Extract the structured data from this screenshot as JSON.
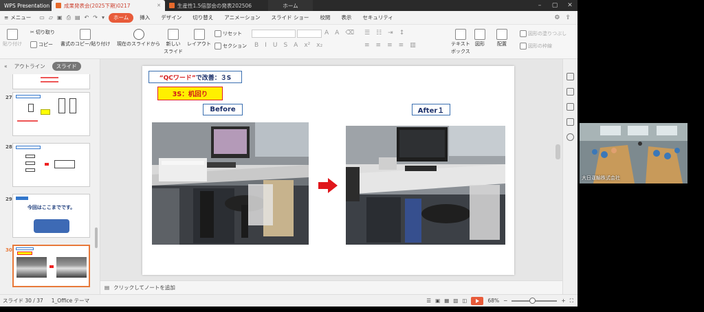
{
  "titlebar": {
    "app": "WPS Presentation",
    "doc1": "成果発表会(2025下期)0217",
    "doc2": "生産性1.5倍部会の発表202506",
    "home": "ホーム"
  },
  "menubar": {
    "menu": "メニュー",
    "tabs": [
      "ホーム",
      "挿入",
      "デザイン",
      "切り替え",
      "アニメーション",
      "スライド ショー",
      "校閲",
      "表示",
      "セキュリティ"
    ],
    "active_tab": "ホーム"
  },
  "ribbon": {
    "paste": "貼り付け",
    "cut": "切り取り",
    "copy": "コピー",
    "format_copy": "書式のコピー/貼り付け",
    "from_current": "現在のスライドから",
    "new_slide_1": "新しい",
    "new_slide_2": "スライド",
    "layout": "レイアウト",
    "reset": "リセット",
    "section": "セクション",
    "textbox_1": "テキスト",
    "textbox_2": "ボックス",
    "shape": "図形",
    "arrange": "配置",
    "align": "図形の塗りつぶし",
    "outline": "図形の枠線"
  },
  "leftpanel": {
    "tab_outline": "アウトライン",
    "tab_slides": "スライド",
    "thumbs": [
      {
        "num": "27"
      },
      {
        "num": "28"
      },
      {
        "num": "29",
        "text": "今回はここまでです。"
      },
      {
        "num": "30"
      }
    ]
  },
  "slide": {
    "title_q": "“QCワード”",
    "title_rest": "で改善：３S",
    "tag": "3S：机回り",
    "before": "Before",
    "after": "After１"
  },
  "notes": {
    "placeholder": "クリックしてノートを追加"
  },
  "status": {
    "slide": "スライド 30 / 37",
    "theme": "1_Office テーマ",
    "zoom": "68%"
  },
  "video": {
    "label": "大日運輸株式会社"
  },
  "colors": {
    "accent": "#e85b3a",
    "title_border": "#3a6fb0",
    "tag_yellow": "#fff000",
    "arrow_red": "#e0161b"
  }
}
